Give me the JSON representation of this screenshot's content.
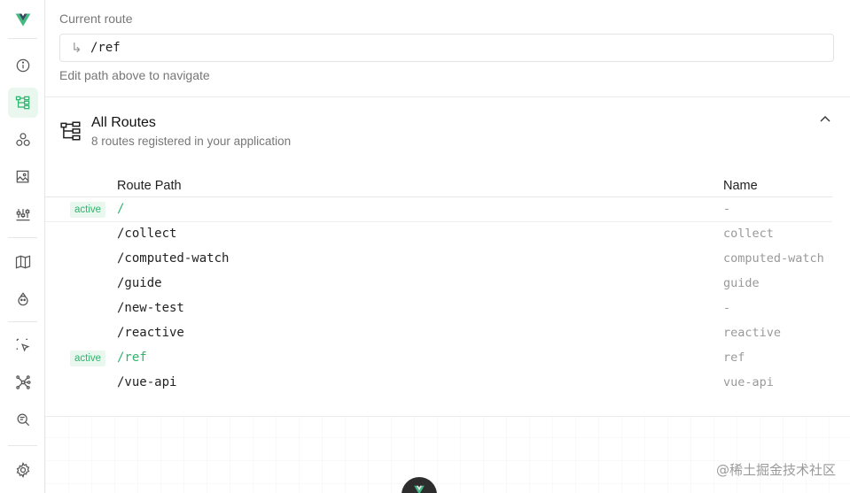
{
  "sidebar": {
    "items": [
      {
        "icon": "vue-logo-icon"
      },
      {
        "icon": "info-icon"
      },
      {
        "icon": "route-tree-icon",
        "active": true
      },
      {
        "icon": "components-icon"
      },
      {
        "icon": "assets-icon"
      },
      {
        "icon": "timeline-icon"
      },
      {
        "icon": "pages-map-icon"
      },
      {
        "icon": "pinia-icon"
      },
      {
        "icon": "inspect-cursor-icon"
      },
      {
        "icon": "graph-icon"
      },
      {
        "icon": "search-inspect-icon"
      },
      {
        "icon": "settings-icon"
      }
    ]
  },
  "current_route": {
    "label": "Current route",
    "arrow": "↳",
    "value": "/ref",
    "hint": "Edit path above to navigate"
  },
  "all_routes": {
    "title": "All Routes",
    "subtitle": "8 routes registered in your application",
    "columns": {
      "path": "Route Path",
      "name": "Name"
    },
    "rows": [
      {
        "badge": "active",
        "path": "/",
        "name": "-",
        "active": true
      },
      {
        "badge": "",
        "path": "/collect",
        "name": "collect",
        "active": false
      },
      {
        "badge": "",
        "path": "/computed-watch",
        "name": "computed-watch",
        "active": false
      },
      {
        "badge": "",
        "path": "/guide",
        "name": "guide",
        "active": false
      },
      {
        "badge": "",
        "path": "/new-test",
        "name": "-",
        "active": false
      },
      {
        "badge": "",
        "path": "/reactive",
        "name": "reactive",
        "active": false
      },
      {
        "badge": "active",
        "path": "/ref",
        "name": "ref",
        "active": true
      },
      {
        "badge": "",
        "path": "/vue-api",
        "name": "vue-api",
        "active": false
      }
    ]
  },
  "watermark": "@稀土掘金技术社区",
  "colors": {
    "accent": "#2fb46e",
    "accent_bg": "#e9f7ef",
    "vue_green": "#42b883",
    "vue_dark": "#35495e"
  }
}
